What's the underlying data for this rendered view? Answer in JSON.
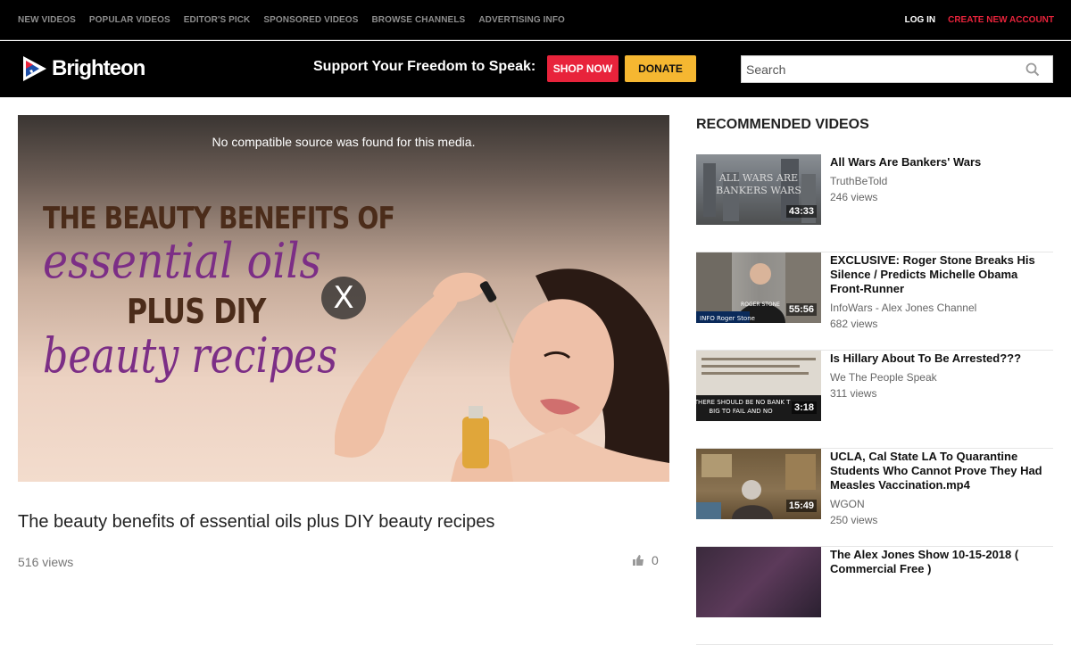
{
  "topnav": {
    "links": [
      "NEW VIDEOS",
      "POPULAR VIDEOS",
      "EDITOR'S PICK",
      "SPONSORED VIDEOS",
      "BROWSE CHANNELS",
      "ADVERTISING INFO"
    ],
    "login": "LOG IN",
    "create_account": "CREATE NEW ACCOUNT"
  },
  "header": {
    "logo_text": "Brighteon",
    "support_text": "Support Your Freedom to Speak:",
    "shop_label": "SHOP NOW",
    "donate_label": "DONATE",
    "search_placeholder": "Search"
  },
  "player": {
    "error_message": "No compatible source was found for this media.",
    "poster": {
      "line1": "THE BEAUTY BENEFITS OF",
      "line2": "essential oils",
      "line3": "PLUS DIY",
      "line4": "beauty recipes"
    },
    "close_label": "X"
  },
  "video": {
    "title": "The beauty benefits of essential oils plus DIY beauty recipes",
    "views": "516 views",
    "likes": "0"
  },
  "sidebar": {
    "heading": "RECOMMENDED VIDEOS",
    "items": [
      {
        "title": "All Wars Are Bankers' Wars",
        "channel": "TruthBeTold",
        "views": "246 views",
        "duration": "43:33"
      },
      {
        "title": "EXCLUSIVE: Roger Stone Breaks His Silence / Predicts Michelle Obama Front-Runner",
        "channel": "InfoWars - Alex Jones Channel",
        "views": "682 views",
        "duration": "55:56"
      },
      {
        "title": "Is Hillary About To Be Arrested???",
        "channel": "We The People Speak",
        "views": "311 views",
        "duration": "3:18"
      },
      {
        "title": "UCLA, Cal State LA To Quarantine Students Who Cannot Prove They Had Measles Vaccination.mp4",
        "channel": "WGON",
        "views": "250 views",
        "duration": "15:49"
      },
      {
        "title": "The Alex Jones Show 10-15-2018 ( Commercial Free )",
        "channel": "",
        "views": "",
        "duration": ""
      }
    ]
  },
  "colors": {
    "accent_red": "#e8233b",
    "donate_yellow": "#f5b731",
    "poster_purple": "#7c2e86",
    "poster_brown": "#4b2c1a"
  }
}
